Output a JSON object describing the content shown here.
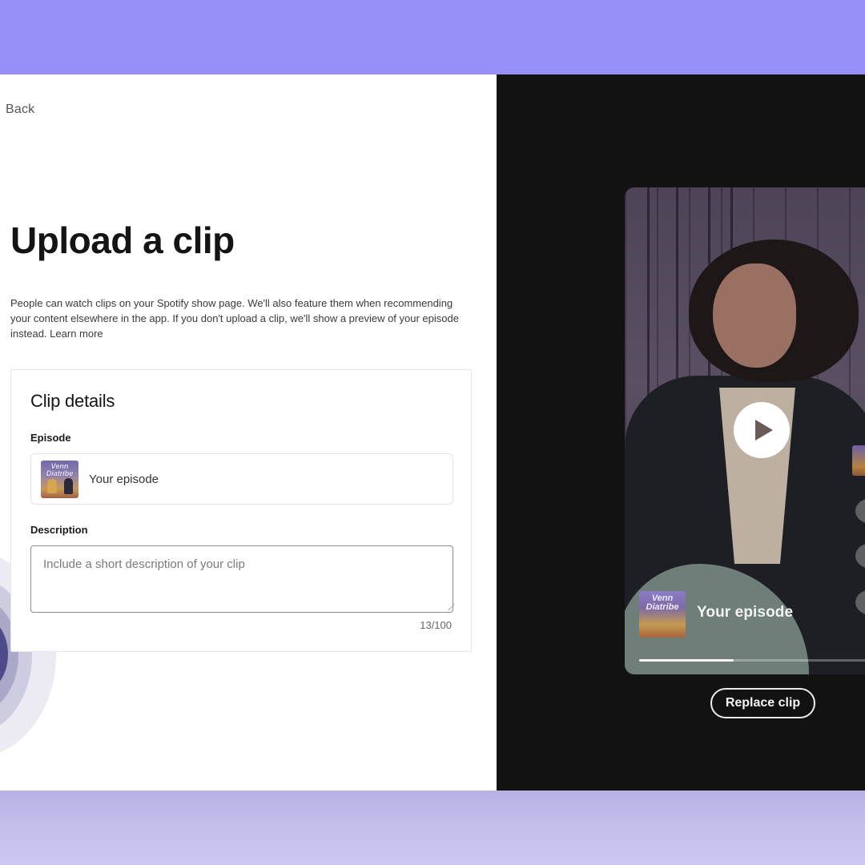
{
  "colors": {
    "background_band": "#9690f8",
    "left_panel": "#ffffff",
    "right_panel": "#121212",
    "title_text": "#141414"
  },
  "nav": {
    "back_label": "Back"
  },
  "page": {
    "title": "Upload a clip",
    "intro": "People can watch clips on your Spotify show page. We'll also feature them when recommending your content elsewhere in the app. If you don't upload a clip, we'll show a preview of your episode instead.",
    "learn_more_label": "Learn more"
  },
  "clip_details": {
    "heading": "Clip details",
    "episode": {
      "label": "Episode",
      "cover_title": "Venn Diatribe",
      "value": "Your episode"
    },
    "description": {
      "label": "Description",
      "placeholder": "Include a short description of your clip",
      "value": "",
      "char_count": "13/100"
    }
  },
  "preview": {
    "play_icon": "play-icon",
    "cover_title": "Venn Diatribe",
    "episode_title": "Your episode",
    "progress": 0.39,
    "replace_label": "Replace clip"
  }
}
